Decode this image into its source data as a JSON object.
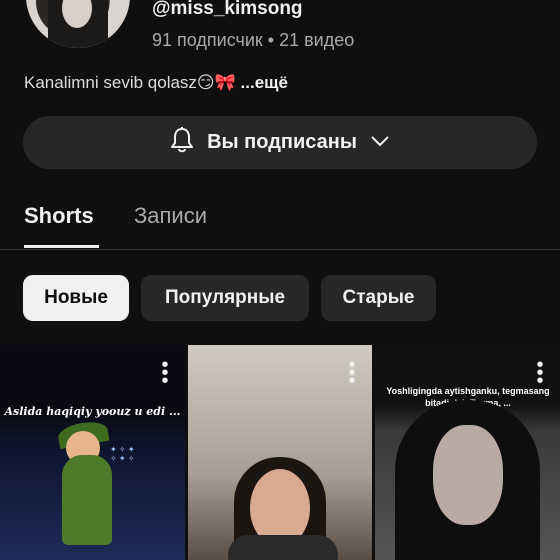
{
  "channel": {
    "handle": "@miss_kimsong",
    "stats": "91 подписчик • 21 видео",
    "description": "Kanalimni sevib qolasz😏🎀",
    "description_more": "...ещё"
  },
  "subscribe": {
    "label": "Вы подписаны"
  },
  "tabs": [
    {
      "label": "Shorts",
      "active": true
    },
    {
      "label": "Записи",
      "active": false
    }
  ],
  "filters": [
    {
      "label": "Новые",
      "selected": true
    },
    {
      "label": "Популярные",
      "selected": false
    },
    {
      "label": "Старые",
      "selected": false
    }
  ],
  "shorts": [
    {
      "caption": "Aslida haqiqiy yoouz u edi ..."
    },
    {
      "caption": ""
    },
    {
      "caption": "Yoshligingda aytishganku, tegmasang bitadi deb Tegma, ..."
    }
  ],
  "icons": {
    "bell": "bell-icon",
    "chevron": "chevron-down-icon",
    "kebab": "more-vert-icon"
  },
  "colors": {
    "background": "#0f0f0f",
    "button_bg": "#272727",
    "chip_selected_bg": "#f1f1f1",
    "text_primary": "#f1f1f1",
    "text_secondary": "#aaaaaa"
  }
}
